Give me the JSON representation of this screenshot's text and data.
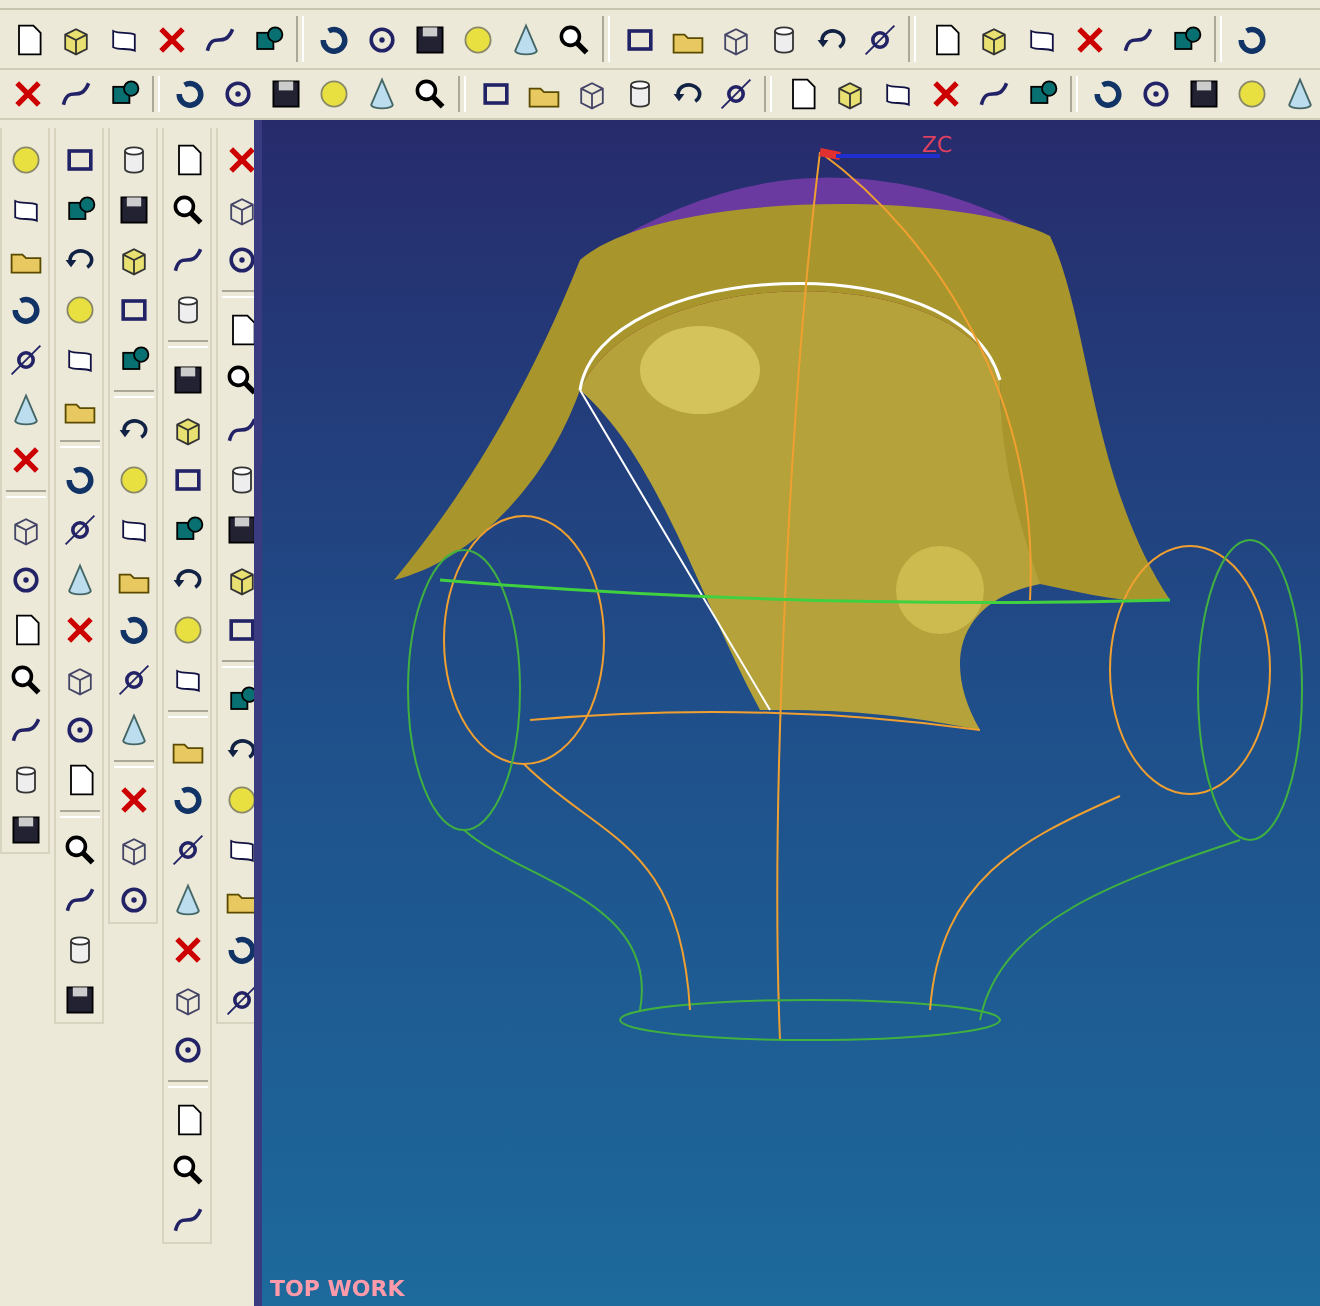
{
  "viewport": {
    "axis_label": "ZC",
    "view_label": "TOP WORK"
  }
}
